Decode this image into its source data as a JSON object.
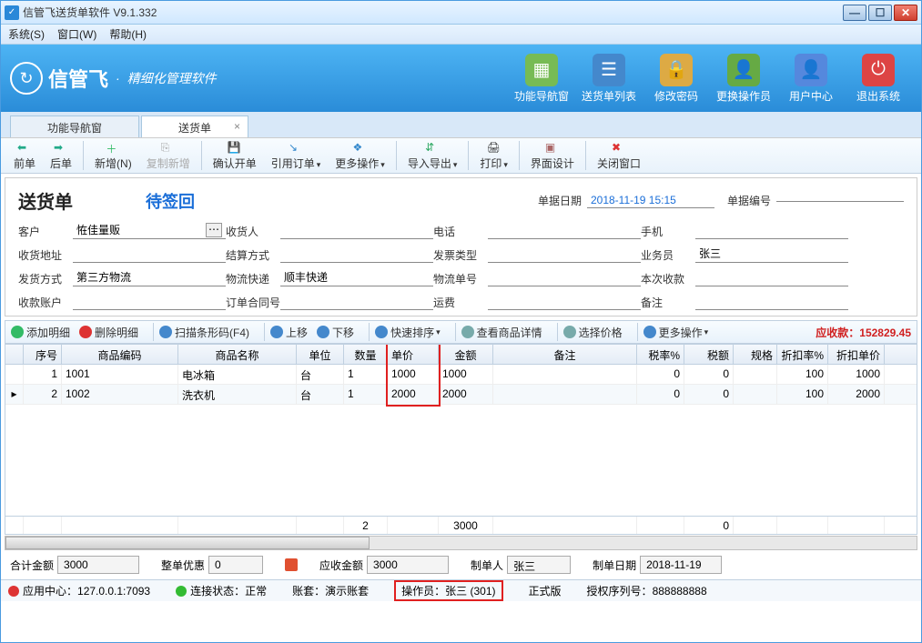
{
  "window": {
    "title": "信管飞送货单软件 V9.1.332"
  },
  "menu": {
    "system": "系统(S)",
    "window": "窗口(W)",
    "help": "帮助(H)"
  },
  "brand": {
    "name": "信管飞",
    "dot": "·",
    "sub": "精细化管理软件"
  },
  "bigbtns": {
    "nav": "功能导航窗",
    "list": "送货单列表",
    "pwd": "修改密码",
    "switch": "更换操作员",
    "user": "用户中心",
    "exit": "退出系统"
  },
  "tabs": {
    "nav": "功能导航窗",
    "form": "送货单",
    "close": "×"
  },
  "toolbar": {
    "prev": "前单",
    "next": "后单",
    "new": "新增(N)",
    "copy": "复制新增",
    "confirm": "确认开单",
    "quote": "引用订单",
    "more": "更多操作",
    "inout": "导入导出",
    "print": "打印",
    "design": "界面设计",
    "closewin": "关闭窗口"
  },
  "form": {
    "title": "送货单",
    "status": "待签回",
    "datelbl": "单据日期",
    "date": "2018-11-19 15:15",
    "nolbl": "单据编号",
    "no": "",
    "customer_l": "客户",
    "customer": "恠佳量贩",
    "recv_l": "收货人",
    "recv": "",
    "phone_l": "电话",
    "phone": "",
    "mobile_l": "手机",
    "mobile": "",
    "addr_l": "收货地址",
    "addr": "",
    "paytype_l": "结算方式",
    "paytype": "",
    "invtype_l": "发票类型",
    "invtype": "",
    "sales_l": "业务员",
    "sales": "张三",
    "ship_l": "发货方式",
    "ship": "第三方物流",
    "express_l": "物流快递",
    "express": "顺丰快递",
    "trackno_l": "物流单号",
    "trackno": "",
    "thispay_l": "本次收款",
    "thispay": "",
    "acct_l": "收款账户",
    "acct": "",
    "contract_l": "订单合同号",
    "contract": "",
    "freight_l": "运费",
    "freight": "",
    "remark_l": "备注",
    "remark": ""
  },
  "gridtool": {
    "add": "添加明细",
    "del": "删除明细",
    "scan": "扫描条形码(F4)",
    "up": "上移",
    "down": "下移",
    "sort": "快速排序",
    "detail": "查看商品详情",
    "price": "选择价格",
    "more": "更多操作",
    "due_l": "应收款：",
    "due": "152829.45"
  },
  "columns": {
    "seq": "序号",
    "code": "商品编码",
    "name": "商品名称",
    "unit": "单位",
    "qty": "数量",
    "price": "单价",
    "amount": "金额",
    "remark": "备注",
    "taxr": "税率%",
    "tax": "税额",
    "spec": "规格",
    "discr": "折扣率%",
    "discp": "折扣单价"
  },
  "rows": [
    {
      "seq": "1",
      "code": "1001",
      "name": "电冰箱",
      "unit": "台",
      "qty": "1",
      "price": "1000",
      "amount": "1000",
      "remark": "",
      "taxr": "0",
      "tax": "0",
      "spec": "",
      "discr": "100",
      "discp": "1000"
    },
    {
      "seq": "2",
      "code": "1002",
      "name": "洗衣机",
      "unit": "台",
      "qty": "1",
      "price": "2000",
      "amount": "2000",
      "remark": "",
      "taxr": "0",
      "tax": "0",
      "spec": "",
      "discr": "100",
      "discp": "2000"
    }
  ],
  "sums": {
    "qty": "2",
    "amount": "3000",
    "tax": "0"
  },
  "footer": {
    "total_l": "合计金额",
    "total": "3000",
    "orderdisc_l": "整单优惠",
    "orderdisc": "0",
    "receivable_l": "应收金额",
    "receivable": "3000",
    "maker_l": "制单人",
    "maker": "张三",
    "makedate_l": "制单日期",
    "makedate": "2018-11-19"
  },
  "status": {
    "appcenter_l": "应用中心：",
    "appcenter": "127.0.0.1:7093",
    "conn_l": "连接状态：",
    "conn": "正常",
    "book_l": "账套：",
    "book": "演示账套",
    "op_l": "操作员：",
    "op": "张三 (301)",
    "ver": "正式版",
    "lic_l": "授权序列号：",
    "lic": "888888888"
  }
}
